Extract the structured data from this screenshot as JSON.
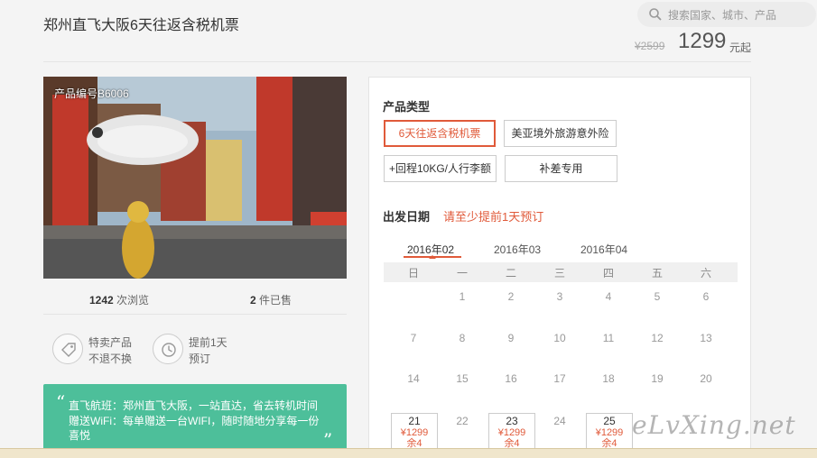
{
  "page": {
    "title": "郑州直飞大阪6天往返含税机票"
  },
  "search": {
    "placeholder": "搜索国家、城市、产品"
  },
  "price": {
    "original": "¥2599",
    "current": "1299",
    "unit": "元起"
  },
  "product": {
    "code": "产品编号B6006"
  },
  "stats": {
    "views": "1242",
    "views_label": "次浏览",
    "sold": "2",
    "sold_label": "件已售"
  },
  "features": [
    {
      "icon": "tag-icon",
      "line1": "特卖产品",
      "line2": "不退不换"
    },
    {
      "icon": "clock-icon",
      "line1": "提前1天",
      "line2": "预订"
    }
  ],
  "highlights": {
    "line1": "直飞航班：郑州直飞大阪，一站直达，省去转机时间",
    "line2": "赠送WiFi：每单赠送一台WIFI，随时随地分享每一份",
    "line3": "喜悦"
  },
  "booking": {
    "type_label": "产品类型",
    "options": [
      "6天往返含税机票",
      "美亚境外旅游意外险",
      "+回程10KG/人行李额",
      "补差专用"
    ],
    "selected_option": "6天往返含税机票",
    "date_label": "出发日期",
    "date_hint": "请至少提前1天预订",
    "months": [
      "2016年02",
      "2016年03",
      "2016年04"
    ],
    "active_month": "2016年02",
    "weekdays": [
      "日",
      "一",
      "二",
      "三",
      "四",
      "五",
      "六"
    ],
    "days_row1": [
      "1",
      "2",
      "3",
      "4",
      "5",
      "6"
    ],
    "days_row2": [
      "7",
      "8",
      "9",
      "10",
      "11",
      "12",
      "13"
    ],
    "days_row3": [
      "14",
      "15",
      "16",
      "17",
      "18",
      "19",
      "20"
    ],
    "days_row4": [
      {
        "day": "21",
        "price": "¥1299",
        "remain": "余4",
        "available": true
      },
      {
        "day": "22",
        "available": false
      },
      {
        "day": "23",
        "price": "¥1299",
        "remain": "余4",
        "available": true
      },
      {
        "day": "24",
        "available": false
      },
      {
        "day": "25",
        "price": "¥1299",
        "remain": "余4",
        "available": true
      }
    ]
  },
  "watermark": "eLvXing.net",
  "colors": {
    "accent": "#e05a3a",
    "green": "#4dbf9a"
  }
}
